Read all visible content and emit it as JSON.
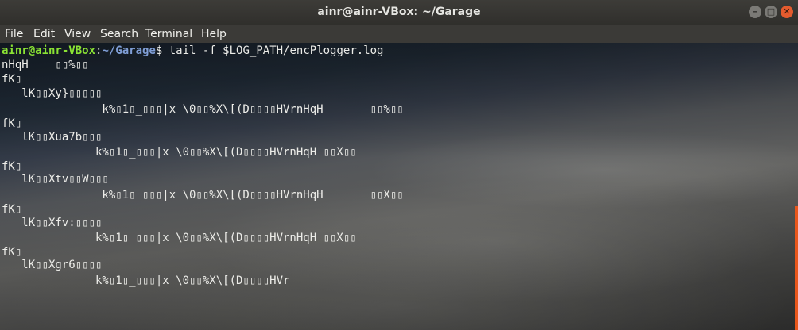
{
  "window": {
    "title": "ainr@ainr-VBox: ~/Garage",
    "buttons": [
      "–",
      "□",
      "✕"
    ]
  },
  "menu": [
    "File",
    "Edit",
    "View",
    "Search",
    "Terminal",
    "Help"
  ],
  "prompt": {
    "user_host": "ainr@ainr-VBox",
    "colon": ":",
    "path": "~/Garage",
    "symbol": "$",
    "command": " tail -f $LOG_PATH/encPlogger.log"
  },
  "lines": [
    "nHqH    ▯▯%▯▯",
    "fK▯",
    "   lK▯▯Xy}▯▯▯▯▯",
    "               k%▯1▯_▯▯▯|x \\0▯▯%X\\[(D▯▯▯▯HVrnHqH       ▯▯%▯▯",
    "fK▯",
    "   lK▯▯Xua7b▯▯▯",
    "              k%▯1▯_▯▯▯|x \\0▯▯%X\\[(D▯▯▯▯HVrnHqH ▯▯X▯▯",
    "fK▯",
    "   lK▯▯Xtv▯▯W▯▯▯",
    "               k%▯1▯_▯▯▯|x \\0▯▯%X\\[(D▯▯▯▯HVrnHqH       ▯▯X▯▯",
    "fK▯",
    "   lK▯▯Xfv:▯▯▯▯",
    "              k%▯1▯_▯▯▯|x \\0▯▯%X\\[(D▯▯▯▯HVrnHqH ▯▯X▯▯",
    "fK▯",
    "   lK▯▯Xgr6▯▯▯▯",
    "              k%▯1▯_▯▯▯|x \\0▯▯%X\\[(D▯▯▯▯HVr"
  ]
}
